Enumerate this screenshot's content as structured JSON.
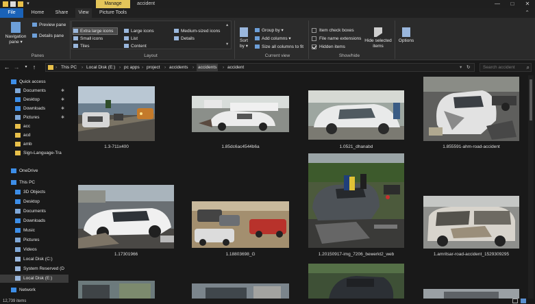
{
  "titlebar": {
    "context_tab": "Manage",
    "title": "accident",
    "minimize": "—",
    "maximize": "□",
    "close": "✕"
  },
  "tabs": [
    "File",
    "Home",
    "Share",
    "View",
    "Picture Tools"
  ],
  "ribbon": {
    "panes": {
      "navigation_pane": "Navigation pane",
      "preview_pane": "Preview pane",
      "details_pane": "Details pane",
      "label": "Panes"
    },
    "layout": {
      "items": [
        "Extra large icons",
        "Large icons",
        "Medium-sized icons",
        "Small icons",
        "List",
        "Details",
        "Tiles",
        "Content"
      ],
      "selected": "Extra large icons",
      "label": "Layout"
    },
    "current_view": {
      "sort_by": "Sort by",
      "group_by": "Group by",
      "add_columns": "Add columns",
      "size_columns": "Size all columns to fit",
      "label": "Current view"
    },
    "show_hide": {
      "item_check_boxes": "Item check boxes",
      "file_name_extensions": "File name extensions",
      "hidden_items": "Hidden items",
      "item_check_boxes_checked": false,
      "file_name_extensions_checked": false,
      "hidden_items_checked": true,
      "hide_selected": "Hide selected items",
      "label": "Show/hide"
    },
    "options": "Options"
  },
  "address": {
    "crumbs": [
      "This PC",
      "Local Disk (E:)",
      "pc apps",
      "project",
      "accidents",
      "accidents",
      "accident"
    ],
    "highlighted_index": 5,
    "search_placeholder": "Search accident"
  },
  "nav": {
    "items": [
      {
        "label": "Quick access",
        "icon": "star-icon",
        "color": "#3d8ee8",
        "indent": 0,
        "pinned": false
      },
      {
        "label": "Documents",
        "icon": "document-folder-icon",
        "color": "#7fa8d8",
        "indent": 1,
        "pinned": true
      },
      {
        "label": "Desktop",
        "icon": "desktop-folder-icon",
        "color": "#3d8ee8",
        "indent": 1,
        "pinned": true
      },
      {
        "label": "Downloads",
        "icon": "download-icon",
        "color": "#3d8ee8",
        "indent": 1,
        "pinned": true
      },
      {
        "label": "Pictures",
        "icon": "pictures-folder-icon",
        "color": "#7fa8d8",
        "indent": 1,
        "pinned": true
      },
      {
        "label": "acc",
        "icon": "folder-icon",
        "color": "#e8c04a",
        "indent": 1,
        "pinned": false
      },
      {
        "label": "acd",
        "icon": "folder-icon",
        "color": "#e8c04a",
        "indent": 1,
        "pinned": false
      },
      {
        "label": "amb",
        "icon": "folder-icon",
        "color": "#e8c04a",
        "indent": 1,
        "pinned": false
      },
      {
        "label": "Sign-Language-Tra",
        "icon": "folder-icon",
        "color": "#e8c04a",
        "indent": 1,
        "pinned": false
      },
      {
        "label": "OneDrive",
        "icon": "cloud-icon",
        "color": "#3d8ee8",
        "indent": 0,
        "pinned": false
      },
      {
        "label": "This PC",
        "icon": "computer-icon",
        "color": "#3d8ee8",
        "indent": 0,
        "pinned": false
      },
      {
        "label": "3D Objects",
        "icon": "3d-objects-icon",
        "color": "#3d8ee8",
        "indent": 1,
        "pinned": false
      },
      {
        "label": "Desktop",
        "icon": "desktop-folder-icon",
        "color": "#3d8ee8",
        "indent": 1,
        "pinned": false
      },
      {
        "label": "Documents",
        "icon": "document-folder-icon",
        "color": "#7fa8d8",
        "indent": 1,
        "pinned": false
      },
      {
        "label": "Downloads",
        "icon": "download-icon",
        "color": "#3d8ee8",
        "indent": 1,
        "pinned": false
      },
      {
        "label": "Music",
        "icon": "music-icon",
        "color": "#3d8ee8",
        "indent": 1,
        "pinned": false
      },
      {
        "label": "Pictures",
        "icon": "pictures-folder-icon",
        "color": "#7fa8d8",
        "indent": 1,
        "pinned": false
      },
      {
        "label": "Videos",
        "icon": "videos-icon",
        "color": "#7fa8d8",
        "indent": 1,
        "pinned": false
      },
      {
        "label": "Local Disk (C:)",
        "icon": "drive-icon",
        "color": "#9ab7dd",
        "indent": 1,
        "pinned": false
      },
      {
        "label": "System Reserved (D",
        "icon": "drive-icon",
        "color": "#9ab7dd",
        "indent": 1,
        "pinned": false
      },
      {
        "label": "Local Disk (E:)",
        "icon": "drive-icon",
        "color": "#9ab7dd",
        "indent": 1,
        "pinned": false,
        "selected": true
      },
      {
        "label": "Network",
        "icon": "network-icon",
        "color": "#3d8ee8",
        "indent": 0,
        "pinned": false
      }
    ]
  },
  "files": [
    {
      "name": "1.3-711x400",
      "scene": "highway-crash"
    },
    {
      "name": "1.85dc6ac4544b6a",
      "scene": "white-car-crumpled"
    },
    {
      "name": "1.0521_dhanabd",
      "scene": "white-hatchback"
    },
    {
      "name": "1.855591-ahm-road-accident",
      "scene": "wrecked-car-debris"
    },
    {
      "name": "1.17301966",
      "scene": "white-sedan-wreck"
    },
    {
      "name": "1.18803698_G",
      "scene": "multi-car-pileup"
    },
    {
      "name": "1.20150917-img_7206_bewerkt2_web",
      "scene": "rescue-scene"
    },
    {
      "name": "1.amritsar-road-accident_1529309295",
      "scene": "suv-wreck"
    }
  ],
  "status": {
    "item_count": "12,739 items"
  }
}
